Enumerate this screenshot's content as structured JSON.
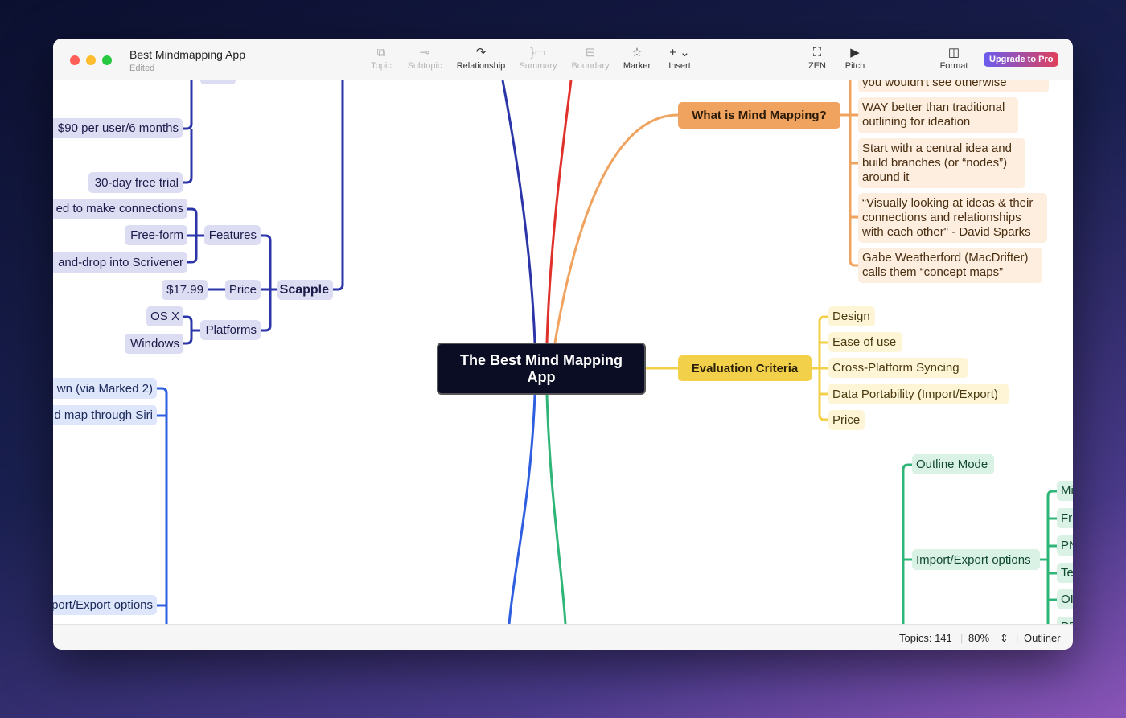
{
  "window": {
    "title": "Best Mindmapping App",
    "subtitle": "Edited"
  },
  "toolbar": {
    "items": [
      {
        "label": "Topic",
        "icon": "topic-icon",
        "enabled": false
      },
      {
        "label": "Subtopic",
        "icon": "subtopic-icon",
        "enabled": false
      },
      {
        "label": "Relationship",
        "icon": "relationship-icon",
        "enabled": true
      },
      {
        "label": "Summary",
        "icon": "summary-icon",
        "enabled": false
      },
      {
        "label": "Boundary",
        "icon": "boundary-icon",
        "enabled": false
      },
      {
        "label": "Marker",
        "icon": "star-icon",
        "enabled": true
      },
      {
        "label": "Insert",
        "icon": "plus-icon",
        "enabled": true
      },
      {
        "label": "ZEN",
        "icon": "fullscreen-icon",
        "enabled": true
      },
      {
        "label": "Pitch",
        "icon": "play-icon",
        "enabled": true
      },
      {
        "label": "Format",
        "icon": "sidebar-icon",
        "enabled": true
      }
    ],
    "upgrade": "Upgrade to Pro"
  },
  "map": {
    "central": "The Best Mind Mapping App",
    "left": {
      "top_partial": "",
      "pricing": [
        "$90 per user/6 months",
        "30-day free trial"
      ],
      "scapple": "Scapple",
      "features": "Features",
      "feature_items": [
        "ed to make connections",
        "Free-form",
        "and-drop into Scrivener"
      ],
      "price": "Price",
      "price_value": "$17.99",
      "platforms": "Platforms",
      "platform_items": [
        "OS X",
        "Windows"
      ],
      "blue_items": [
        "wn (via Marked 2)",
        "d map through Siri",
        "port/Export options"
      ]
    },
    "what": {
      "title": "What is Mind Mapping?",
      "items": [
        "you wouldn't see otherwise",
        "WAY better than traditional outlining for ideation",
        "Start with a central idea and build branches (or “nodes”) around it",
        "“Visually looking at ideas & their connections and relationships with each other\" - David Sparks",
        "Gabe Weatherford (MacDrifter) calls them “concept maps”"
      ]
    },
    "criteria": {
      "title": "Evaluation Criteria",
      "items": [
        "Design",
        "Ease of use",
        "Cross-Platform Syncing",
        "Data Portability (Import/Export)",
        "Price"
      ]
    },
    "green": {
      "outline": "Outline Mode",
      "import": "Import/Export options",
      "items": [
        "Mi",
        "Fr",
        "PN",
        "Te",
        "OI",
        "PD"
      ]
    },
    "colors": {
      "orange": "#f0a35e",
      "yellow": "#f2d04a",
      "green": "#2fb578",
      "blue": "#2f5fe0",
      "navy": "#2b35a8",
      "red": "#e0302a"
    }
  },
  "status": {
    "topics": "Topics: 141",
    "zoom": "80%",
    "outliner": "Outliner"
  }
}
